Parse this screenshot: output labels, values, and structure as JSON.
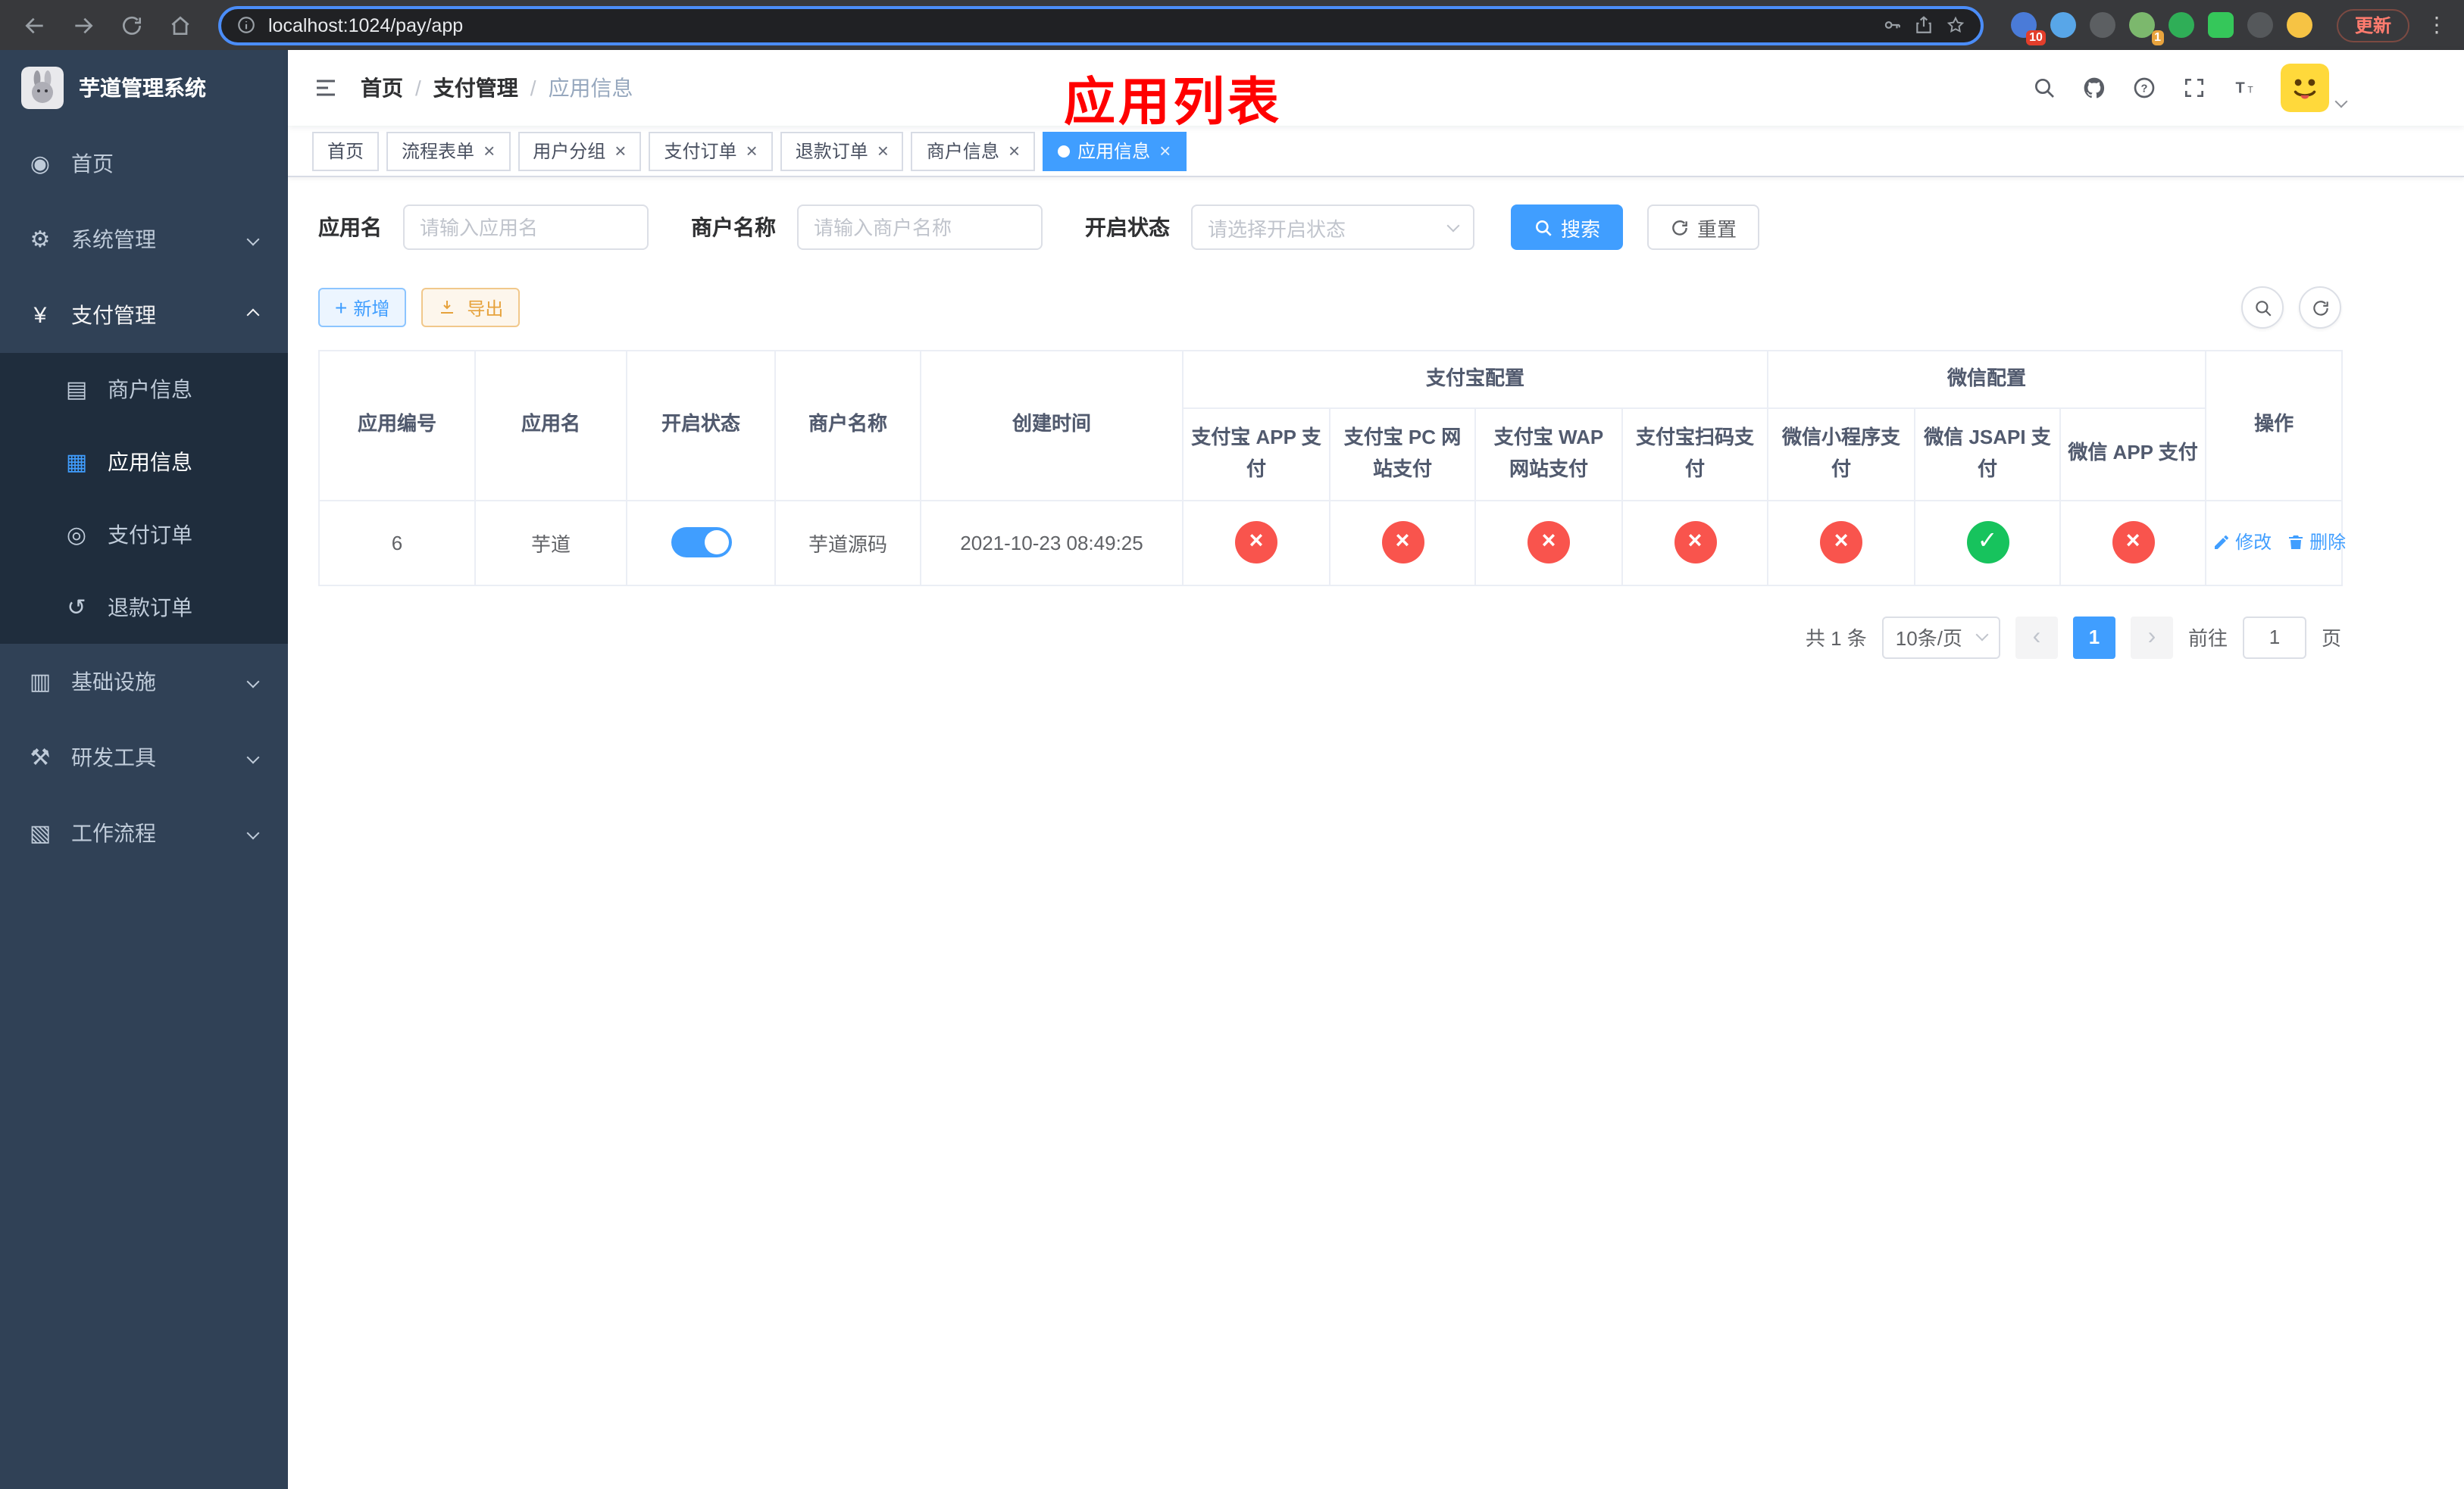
{
  "browser": {
    "url": "localhost:1024/pay/app",
    "update_button": "更新",
    "toolbar_icons": [
      "back-icon",
      "forward-icon",
      "reload-icon",
      "home-icon",
      "site-info-icon",
      "key-icon",
      "share-icon",
      "star-icon",
      "menu-dots-icon"
    ],
    "extensions": [
      {
        "name": "puzzle-extension-icon",
        "color": "#4a7bd8",
        "badge": "10",
        "badge_color": "#e33e2b"
      },
      {
        "name": "drop-extension-icon",
        "color": "#58a6e8"
      },
      {
        "name": "dark-extension-icon",
        "color": "#5c5f62"
      },
      {
        "name": "avatar-extension-icon",
        "color": "#7cb86d",
        "badge": "1",
        "badge_color": "#e8a33d"
      },
      {
        "name": "check-extension-icon",
        "color": "#2fae57"
      },
      {
        "name": "chat-extension-icon",
        "color": "#35c75a",
        "shape": "square"
      },
      {
        "name": "pin-extension-icon",
        "color": "#55585b"
      },
      {
        "name": "emoji-extension-icon",
        "color": "#f6c344"
      }
    ]
  },
  "sidebar": {
    "logo_title": "芋道管理系统",
    "menu": [
      {
        "label": "首页",
        "icon": "dashboard-icon"
      },
      {
        "label": "系统管理",
        "icon": "gear-icon",
        "chevron": "down"
      },
      {
        "label": "支付管理",
        "icon": "yen-icon",
        "chevron": "up",
        "active": true,
        "children": [
          {
            "label": "商户信息",
            "icon": "card-icon"
          },
          {
            "label": "应用信息",
            "icon": "grid-icon",
            "active": true
          },
          {
            "label": "支付订单",
            "icon": "order-icon"
          },
          {
            "label": "退款订单",
            "icon": "refund-icon"
          }
        ]
      },
      {
        "label": "基础设施",
        "icon": "infra-icon",
        "chevron": "down"
      },
      {
        "label": "研发工具",
        "icon": "tools-icon",
        "chevron": "down"
      },
      {
        "label": "工作流程",
        "icon": "workflow-icon",
        "chevron": "down"
      }
    ]
  },
  "header": {
    "breadcrumb": [
      "首页",
      "支付管理",
      "应用信息"
    ],
    "overlay_title": "应用列表",
    "action_icons": [
      "search-icon",
      "github-icon",
      "question-icon",
      "fullscreen-icon",
      "font-size-icon",
      "avatar"
    ]
  },
  "tabs": [
    {
      "label": "首页",
      "closable": false,
      "active": false
    },
    {
      "label": "流程表单",
      "closable": true,
      "active": false
    },
    {
      "label": "用户分组",
      "closable": true,
      "active": false
    },
    {
      "label": "支付订单",
      "closable": true,
      "active": false
    },
    {
      "label": "退款订单",
      "closable": true,
      "active": false
    },
    {
      "label": "商户信息",
      "closable": true,
      "active": false
    },
    {
      "label": "应用信息",
      "closable": true,
      "active": true
    }
  ],
  "filters": {
    "app_name_label": "应用名",
    "app_name_placeholder": "请输入应用名",
    "merchant_label": "商户名称",
    "merchant_placeholder": "请输入商户名称",
    "status_label": "开启状态",
    "status_placeholder": "请选择开启状态",
    "search_button": "搜索",
    "reset_button": "重置"
  },
  "toolbar": {
    "add_button": "新增",
    "export_button": "导出"
  },
  "table": {
    "headers": {
      "app_id": "应用编号",
      "app_name": "应用名",
      "status": "开启状态",
      "merchant_name": "商户名称",
      "create_time": "创建时间",
      "alipay_group": "支付宝配置",
      "wechat_group": "微信配置",
      "alipay_app": "支付宝 APP 支付",
      "alipay_pc": "支付宝 PC 网站支付",
      "alipay_wap": "支付宝 WAP 网站支付",
      "alipay_qr": "支付宝扫码支付",
      "wechat_mini": "微信小程序支付",
      "wechat_jsapi": "微信 JSAPI 支付",
      "wechat_app": "微信 APP 支付",
      "actions": "操作"
    },
    "rows": [
      {
        "app_id": "6",
        "app_name": "芋道",
        "status_enabled": true,
        "merchant_name": "芋道源码",
        "create_time": "2021-10-23 08:49:25",
        "configs": [
          "no",
          "no",
          "no",
          "no",
          "no",
          "yes",
          "no"
        ],
        "edit_label": "修改",
        "delete_label": "删除"
      }
    ]
  },
  "pagination": {
    "total_text": "共 1 条",
    "page_size_text": "10条/页",
    "current_page": "1",
    "goto_prefix": "前往",
    "goto_value": "1",
    "goto_suffix": "页"
  },
  "colors": {
    "primary": "#409eff",
    "danger_circle": "#f9544d",
    "success_circle": "#17c35d",
    "warning": "#e6a23c",
    "sidebar_bg": "#304156",
    "submenu_bg": "#1f2d3d",
    "overlay_title_red": "#ff0000"
  }
}
